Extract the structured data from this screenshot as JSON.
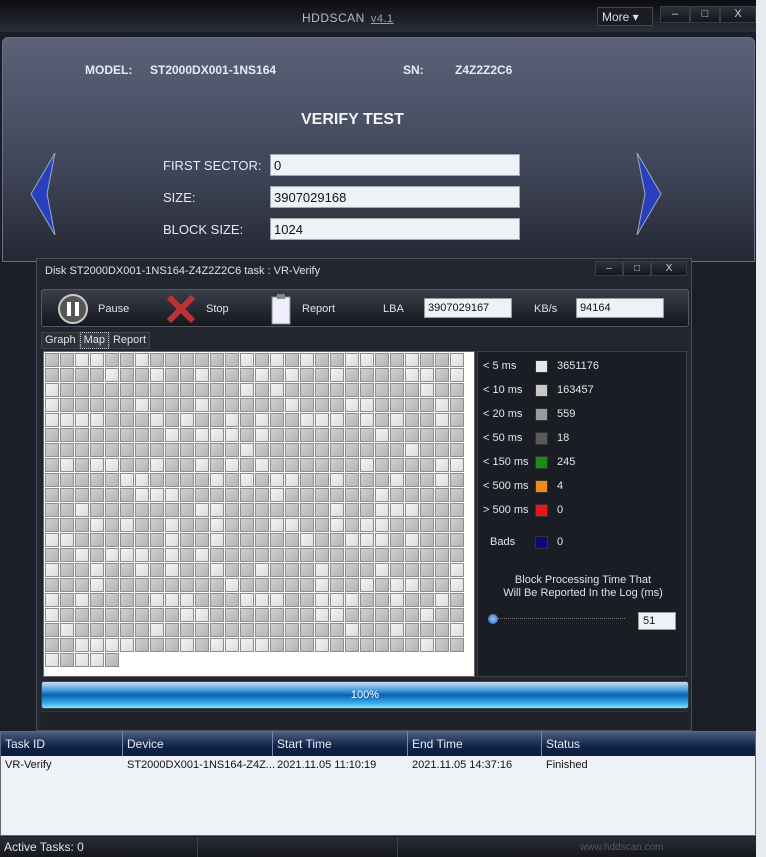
{
  "app": {
    "title": "HDDSCAN",
    "version": "v4.1",
    "more_label": "More ▾",
    "minimize": "–",
    "maximize": "□",
    "close": "X"
  },
  "header": {
    "model_label": "MODEL:",
    "model": "ST2000DX001-1NS164",
    "sn_label": "SN:",
    "sn": "Z4Z2Z2C6",
    "test_title": "VERIFY TEST"
  },
  "form": {
    "first_sector_label": "FIRST SECTOR:",
    "first_sector": "0",
    "size_label": "SIZE:",
    "size": "3907029168",
    "block_size_label": "BLOCK SIZE:",
    "block_size": "1024"
  },
  "task_window": {
    "title": "Disk ST2000DX001-1NS164-Z4Z2Z2C6   task : VR-Verify",
    "toolbar": {
      "pause": "Pause",
      "stop": "Stop",
      "report": "Report",
      "lba_label": "LBA",
      "lba": "3907029167",
      "kbs_label": "KB/s",
      "kbs": "94164"
    },
    "tabs": [
      {
        "label": "Graph"
      },
      {
        "label": "Map",
        "active": true
      },
      {
        "label": "Report"
      }
    ],
    "legend": [
      {
        "label": "< 5 ms",
        "color": "#e8e8e8",
        "count": "3651176"
      },
      {
        "label": "< 10 ms",
        "color": "#c8c8c8",
        "count": "163457"
      },
      {
        "label": "< 20 ms",
        "color": "#9a9a9a",
        "count": "559"
      },
      {
        "label": "< 50 ms",
        "color": "#5a5a5a",
        "count": "18"
      },
      {
        "label": "< 150 ms",
        "color": "#1a8a1a",
        "count": "245"
      },
      {
        "label": "< 500 ms",
        "color": "#f08a1a",
        "count": "4"
      },
      {
        "label": "> 500 ms",
        "color": "#e81818",
        "count": "0"
      },
      {
        "label": "Bads",
        "color": "#0a0a80",
        "count": "0"
      }
    ],
    "threshold_note_1": "Block Processing Time That",
    "threshold_note_2": "Will Be Reported In the Log (ms)",
    "threshold_value": "51",
    "progress": {
      "percent": 100,
      "label": "100%"
    }
  },
  "tasks_table": {
    "columns": [
      "Task ID",
      "Device",
      "Start Time",
      "End Time",
      "Status"
    ],
    "rows": [
      [
        "VR-Verify",
        "ST2000DX001-1NS164-Z4Z...",
        "2021.11.05 11:10:19",
        "2021.11.05 14:37:16",
        "Finished"
      ]
    ]
  },
  "statusbar": {
    "active_tasks": "Active Tasks: 0",
    "website": "www.hddscan.com"
  }
}
